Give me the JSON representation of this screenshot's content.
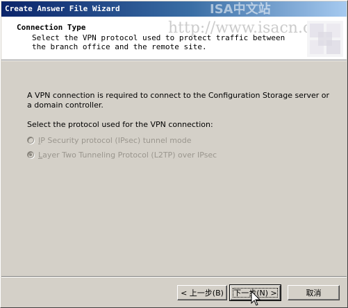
{
  "window": {
    "title": "Create Answer File Wizard",
    "watermark": "ISA中文站"
  },
  "header": {
    "title": "Connection Type",
    "subtitle": "Select the VPN protocol used to protect traffic between the branch office and the remote site.",
    "url_watermark": "http://www.isacn.org"
  },
  "content": {
    "intro": "A VPN connection is required to connect to the Configuration Storage server or a domain controller.",
    "prompt": "Select the protocol used for the VPN connection:",
    "options": [
      {
        "mnemonic": "I",
        "rest": "P Security protocol (IPsec) tunnel mode",
        "checked": false,
        "enabled": false
      },
      {
        "mnemonic": "L",
        "rest": "ayer Two Tunneling Protocol (L2TP) over IPsec",
        "checked": true,
        "enabled": false
      }
    ]
  },
  "buttons": {
    "back": "< 上一步(B)",
    "next": "下一步(N) >",
    "cancel": "取消"
  },
  "colors": {
    "title_start": "#0a246a",
    "title_end": "#a6caf0",
    "face": "#d4d0c8",
    "disabled_text": "#9a968e"
  }
}
